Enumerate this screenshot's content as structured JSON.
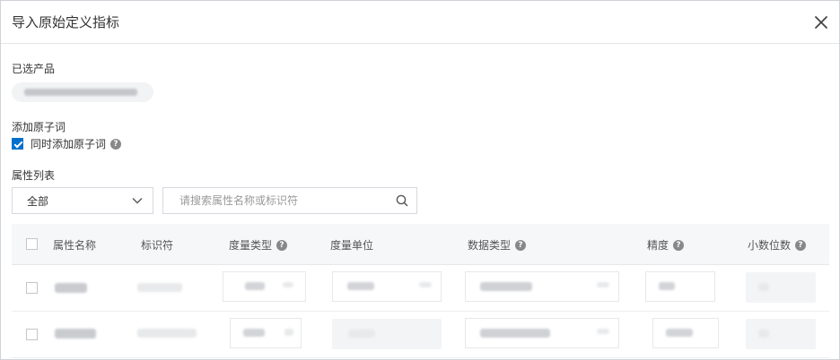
{
  "dialog": {
    "title": "导入原始定义指标",
    "close_icon": "close-icon"
  },
  "product": {
    "label": "已选产品"
  },
  "atoms": {
    "label": "添加原子词",
    "checkbox_label": "同时添加原子词",
    "checked": true
  },
  "attributes": {
    "label": "属性列表",
    "filter_value": "全部",
    "search_placeholder": "请搜索属性名称或标识符"
  },
  "table": {
    "columns": [
      "属性名称",
      "标识符",
      "度量类型",
      "度量单位",
      "数据类型",
      "精度",
      "小数位数"
    ]
  },
  "colors": {
    "accent": "#0070cc",
    "border": "#d6d9de",
    "header_bg": "#f6f7f9"
  }
}
